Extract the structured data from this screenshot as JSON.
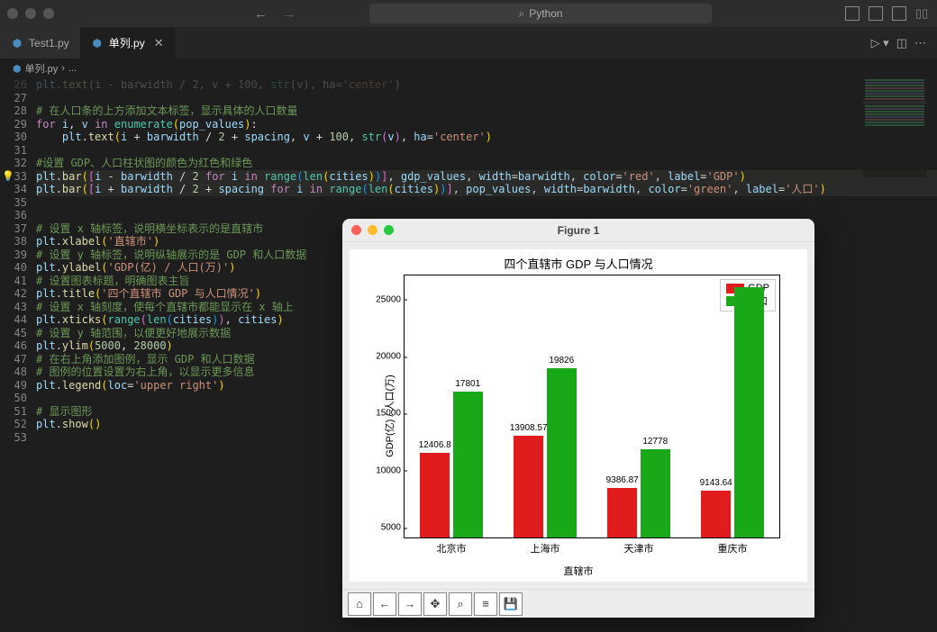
{
  "search_placeholder": "Python",
  "tabs": [
    {
      "label": "Test1.py",
      "active": false
    },
    {
      "label": "单列.py",
      "active": true
    }
  ],
  "breadcrumb": {
    "file_icon": "py",
    "file": "单列.py",
    "sep": "›",
    "rest": "..."
  },
  "line_start": 27,
  "line_end": 53,
  "code26": "plt.text(i - barwidth / 2, v + 100, str(v), ha='center')",
  "comments": {
    "l28": "# 在人口条的上方添加文本标签，显示具体的人口数量",
    "l32": "#设置 GDP、人口柱状图的颜色为红色和绿色",
    "l37": "# 设置 x 轴标签，说明横坐标表示的是直辖市",
    "l39": "# 设置 y 轴标签，说明纵轴展示的是 GDP 和人口数据",
    "l41": "# 设置图表标题，明确图表主旨",
    "l43": "# 设置 x 轴刻度，使每个直辖市都能显示在 x 轴上",
    "l45": "# 设置 y 轴范围，以便更好地展示数据",
    "l47": "# 在右上角添加图例，显示 GDP 和人口数据",
    "l48": "# 图例的位置设置为右上角，以显示更多信息",
    "l51": "# 显示图形"
  },
  "strings": {
    "center": "'center'",
    "red": "'red'",
    "green": "'green'",
    "gdp": "'GDP'",
    "pop": "'人口'",
    "xlab": "'直辖市'",
    "ylab": "'GDP(亿) / 人口(万)'",
    "title": "'四个直辖市 GDP 与人口情况'",
    "loc": "'upper right'"
  },
  "chart_window_title": "Figure 1",
  "chart_data": {
    "type": "bar",
    "title": "四个直辖市 GDP 与人口情况",
    "xlabel": "直辖市",
    "ylabel": "GDP(亿) / 人口(万)",
    "categories": [
      "北京市",
      "上海市",
      "天津市",
      "重庆市"
    ],
    "series": [
      {
        "name": "GDP",
        "color": "#e01c1c",
        "values": [
          12406.8,
          13908.57,
          9386.87,
          9143.64
        ]
      },
      {
        "name": "人口",
        "color": "#18a818",
        "values": [
          17801,
          19826,
          12778,
          27000
        ]
      }
    ],
    "ylim": [
      5000,
      28000
    ],
    "yticks": [
      5000,
      10000,
      15000,
      20000,
      25000
    ],
    "legend_loc": "upper right",
    "bar_labels": {
      "gdp": [
        "12406.8",
        "13908.57",
        "9386.87",
        "9143.64"
      ],
      "pop": [
        "17801",
        "19826",
        "12778",
        ""
      ]
    }
  },
  "fig_tools": [
    "home",
    "back",
    "forward",
    "pan",
    "zoom",
    "configure",
    "save"
  ]
}
